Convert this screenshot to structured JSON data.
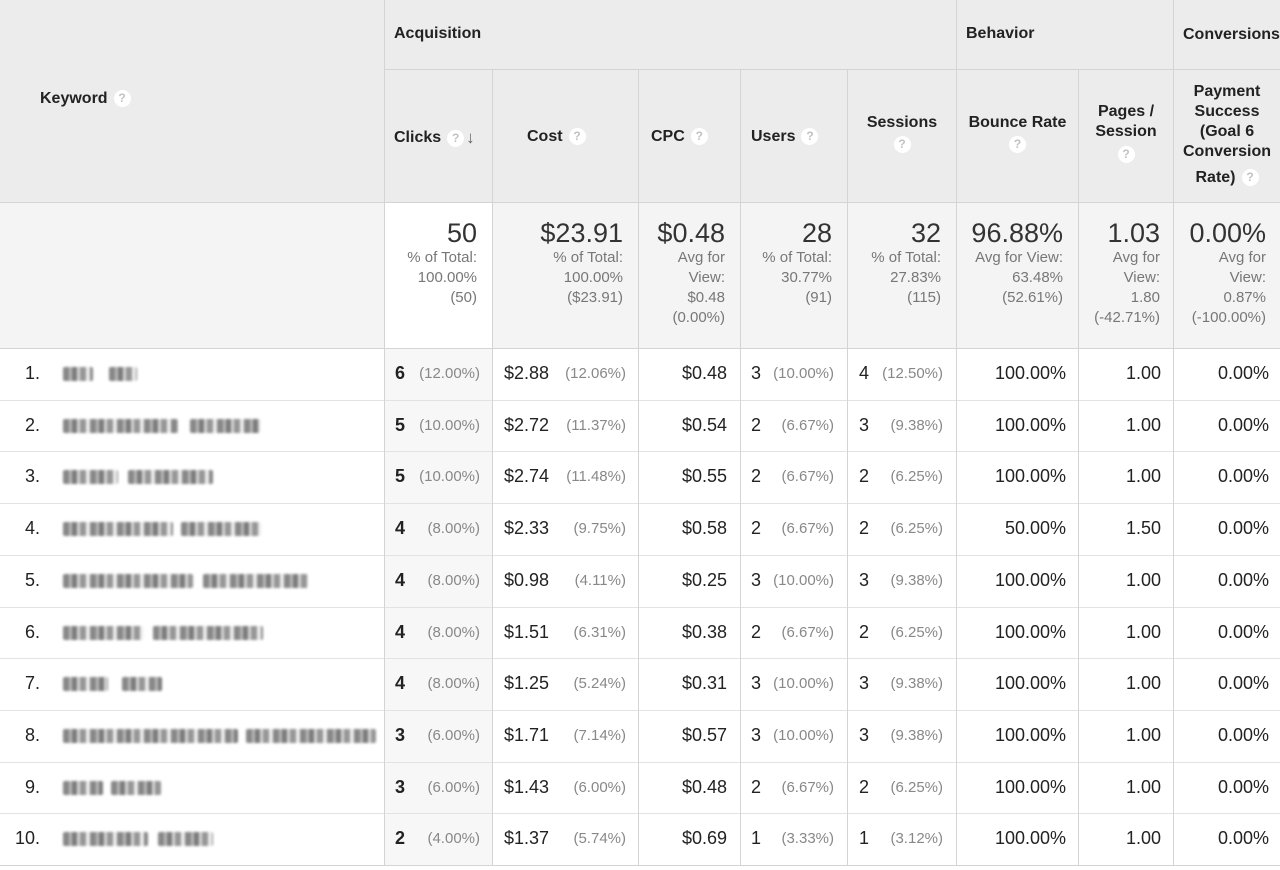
{
  "header": {
    "keyword": "Keyword",
    "groups": {
      "acquisition": "Acquisition",
      "behavior": "Behavior",
      "conversions": "Conversions"
    },
    "columns": {
      "clicks": "Clicks",
      "cost": "Cost",
      "cpc": "CPC",
      "users": "Users",
      "sessions": "Sessions",
      "bounce_line1": "Bounce Rate",
      "pages_line1": "Pages /",
      "pages_line2": "Session",
      "payment_line1": "Payment",
      "payment_line2": "Success",
      "payment_line3": "(Goal 6",
      "payment_line4": "Conversion",
      "payment_line5": "Rate)"
    },
    "help_glyph": "?",
    "sort_glyph": "↓",
    "icons": {
      "help": "help-icon",
      "sort": "sort-descending-icon"
    }
  },
  "totals": {
    "clicks": {
      "value": "50",
      "l1": "% of Total:",
      "l2": "100.00%",
      "l3": "(50)"
    },
    "cost": {
      "value": "$23.91",
      "l1": "% of Total:",
      "l2": "100.00%",
      "l3": "($23.91)"
    },
    "cpc": {
      "value": "$0.48",
      "l1": "Avg for",
      "l2": "View:",
      "l3": "$0.48",
      "l4": "(0.00%)"
    },
    "users": {
      "value": "28",
      "l1": "% of Total:",
      "l2": "30.77%",
      "l3": "(91)"
    },
    "sessions": {
      "value": "32",
      "l1": "% of Total:",
      "l2": "27.83%",
      "l3": "(115)"
    },
    "bounce": {
      "value": "96.88%",
      "l1": "Avg for View:",
      "l2": "63.48%",
      "l3": "(52.61%)"
    },
    "pages": {
      "value": "1.03",
      "l1": "Avg for",
      "l2": "View:",
      "l3": "1.80",
      "l4": "(-42.71%)"
    },
    "payment": {
      "value": "0.00%",
      "l1": "Avg for",
      "l2": "View:",
      "l3": "0.87%",
      "l4": "(-100.00%)"
    }
  },
  "rows": [
    {
      "idx": "1.",
      "clicks": "6",
      "clicks_pct": "(12.00%)",
      "cost": "$2.88",
      "cost_pct": "(12.06%)",
      "cpc": "$0.48",
      "users": "3",
      "users_pct": "(10.00%)",
      "sessions": "4",
      "sessions_pct": "(12.50%)",
      "bounce": "100.00%",
      "pages": "1.00",
      "payment": "0.00%"
    },
    {
      "idx": "2.",
      "clicks": "5",
      "clicks_pct": "(10.00%)",
      "cost": "$2.72",
      "cost_pct": "(11.37%)",
      "cpc": "$0.54",
      "users": "2",
      "users_pct": "(6.67%)",
      "sessions": "3",
      "sessions_pct": "(9.38%)",
      "bounce": "100.00%",
      "pages": "1.00",
      "payment": "0.00%"
    },
    {
      "idx": "3.",
      "clicks": "5",
      "clicks_pct": "(10.00%)",
      "cost": "$2.74",
      "cost_pct": "(11.48%)",
      "cpc": "$0.55",
      "users": "2",
      "users_pct": "(6.67%)",
      "sessions": "2",
      "sessions_pct": "(6.25%)",
      "bounce": "100.00%",
      "pages": "1.00",
      "payment": "0.00%"
    },
    {
      "idx": "4.",
      "clicks": "4",
      "clicks_pct": "(8.00%)",
      "cost": "$2.33",
      "cost_pct": "(9.75%)",
      "cpc": "$0.58",
      "users": "2",
      "users_pct": "(6.67%)",
      "sessions": "2",
      "sessions_pct": "(6.25%)",
      "bounce": "50.00%",
      "pages": "1.50",
      "payment": "0.00%"
    },
    {
      "idx": "5.",
      "clicks": "4",
      "clicks_pct": "(8.00%)",
      "cost": "$0.98",
      "cost_pct": "(4.11%)",
      "cpc": "$0.25",
      "users": "3",
      "users_pct": "(10.00%)",
      "sessions": "3",
      "sessions_pct": "(9.38%)",
      "bounce": "100.00%",
      "pages": "1.00",
      "payment": "0.00%"
    },
    {
      "idx": "6.",
      "clicks": "4",
      "clicks_pct": "(8.00%)",
      "cost": "$1.51",
      "cost_pct": "(6.31%)",
      "cpc": "$0.38",
      "users": "2",
      "users_pct": "(6.67%)",
      "sessions": "2",
      "sessions_pct": "(6.25%)",
      "bounce": "100.00%",
      "pages": "1.00",
      "payment": "0.00%"
    },
    {
      "idx": "7.",
      "clicks": "4",
      "clicks_pct": "(8.00%)",
      "cost": "$1.25",
      "cost_pct": "(5.24%)",
      "cpc": "$0.31",
      "users": "3",
      "users_pct": "(10.00%)",
      "sessions": "3",
      "sessions_pct": "(9.38%)",
      "bounce": "100.00%",
      "pages": "1.00",
      "payment": "0.00%"
    },
    {
      "idx": "8.",
      "clicks": "3",
      "clicks_pct": "(6.00%)",
      "cost": "$1.71",
      "cost_pct": "(7.14%)",
      "cpc": "$0.57",
      "users": "3",
      "users_pct": "(10.00%)",
      "sessions": "3",
      "sessions_pct": "(9.38%)",
      "bounce": "100.00%",
      "pages": "1.00",
      "payment": "0.00%"
    },
    {
      "idx": "9.",
      "clicks": "3",
      "clicks_pct": "(6.00%)",
      "cost": "$1.43",
      "cost_pct": "(6.00%)",
      "cpc": "$0.48",
      "users": "2",
      "users_pct": "(6.67%)",
      "sessions": "2",
      "sessions_pct": "(6.25%)",
      "bounce": "100.00%",
      "pages": "1.00",
      "payment": "0.00%"
    },
    {
      "idx": "10.",
      "clicks": "2",
      "clicks_pct": "(4.00%)",
      "cost": "$1.37",
      "cost_pct": "(5.74%)",
      "cpc": "$0.69",
      "users": "1",
      "users_pct": "(3.33%)",
      "sessions": "1",
      "sessions_pct": "(3.12%)",
      "bounce": "100.00%",
      "pages": "1.00",
      "payment": "0.00%"
    }
  ]
}
